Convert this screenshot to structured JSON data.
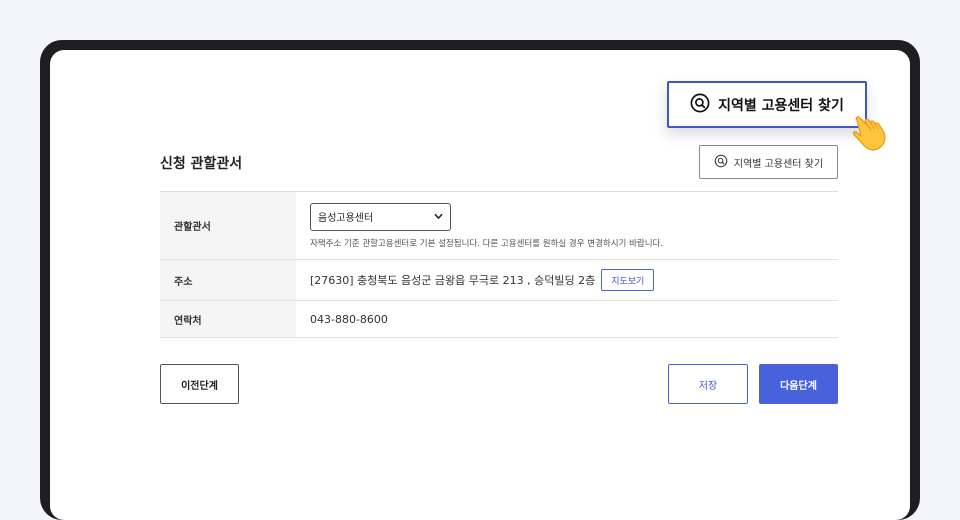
{
  "colors": {
    "accent": "#4862db",
    "accent_border": "#3f56c9",
    "frame": "#1e1e22",
    "page_bg": "#f4f5f8"
  },
  "callout": {
    "label": "지역별 고용센터 찾기",
    "icon": "search-icon"
  },
  "section": {
    "title": "신청 관할관서"
  },
  "find_button": {
    "label": "지역별 고용센터 찾기",
    "icon": "search-icon"
  },
  "rows": {
    "office": {
      "label": "관할관서",
      "selected": "음성고용센터",
      "help": "자택주소 기준 관할고용센터로 기본 설정됩니다. 다른 고용센터를 원하실 경우 변경하시기 바랍니다."
    },
    "address": {
      "label": "주소",
      "value": "[27630] 충청북도 음성군 금왕읍 무극로 213 , 승덕빌딩 2층",
      "map_button": "지도보기"
    },
    "contact": {
      "label": "연락처",
      "value": "043-880-8600"
    }
  },
  "buttons": {
    "prev": "이전단계",
    "save": "저장",
    "next": "다음단계"
  }
}
